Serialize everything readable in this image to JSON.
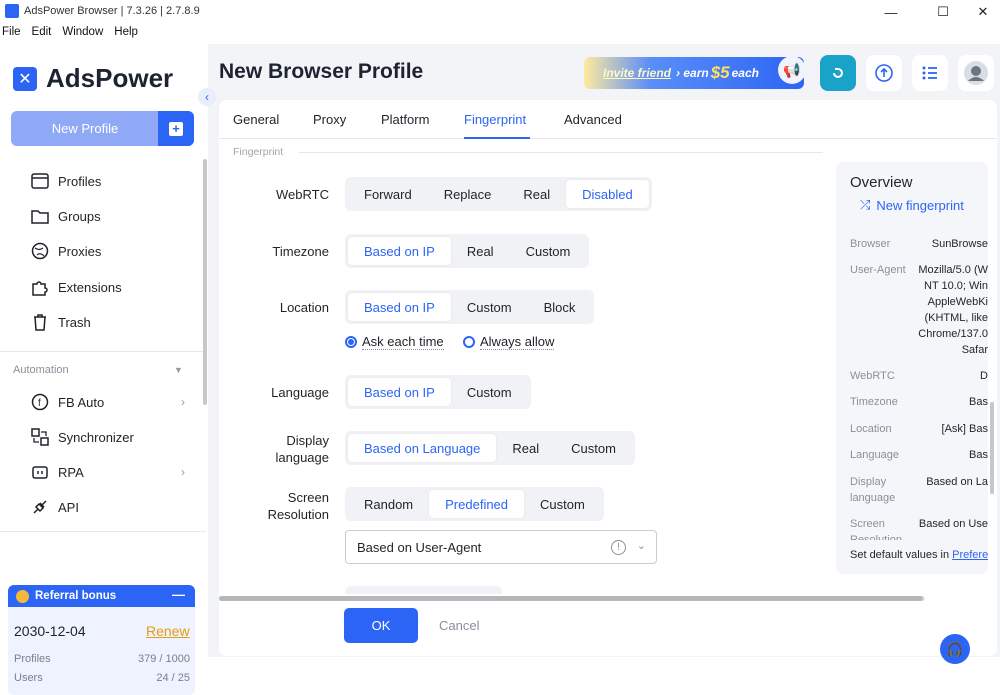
{
  "window": {
    "title": "AdsPower Browser | 7.3.26 | 2.7.8.9",
    "minimize": "—",
    "maximize": "☐",
    "close": "✕"
  },
  "menu": [
    "File",
    "Edit",
    "Window",
    "Help"
  ],
  "sidebar": {
    "brand": "AdsPower",
    "new_profile": "New Profile",
    "items": [
      {
        "label": "Profiles",
        "icon": "profiles-icon"
      },
      {
        "label": "Groups",
        "icon": "folder-icon"
      },
      {
        "label": "Proxies",
        "icon": "globe-icon"
      },
      {
        "label": "Extensions",
        "icon": "puzzle-icon"
      },
      {
        "label": "Trash",
        "icon": "trash-icon"
      }
    ],
    "automation_title": "Automation",
    "automation_items": [
      {
        "label": "FB Auto",
        "icon": "facebook-icon",
        "chevron": "›"
      },
      {
        "label": "Synchronizer",
        "icon": "sync-icon",
        "chevron": ""
      },
      {
        "label": "RPA",
        "icon": "robot-icon",
        "chevron": "›"
      },
      {
        "label": "API",
        "icon": "api-icon",
        "chevron": ""
      }
    ],
    "referral": {
      "title": "Referral bonus",
      "date": "2030-12-04",
      "renew": "Renew",
      "profiles_label": "Profiles",
      "profiles_value": "379 / 1000",
      "users_label": "Users",
      "users_value": "24 / 25"
    }
  },
  "header": {
    "title": "New Browser Profile",
    "banner_text": "Invite friend",
    "banner_earn": "› earn",
    "banner_amount": "$5",
    "banner_each": "each"
  },
  "tabs": [
    "General",
    "Proxy",
    "Platform",
    "Fingerprint",
    "Advanced"
  ],
  "active_tab": "Fingerprint",
  "section_label": "Fingerprint",
  "form": {
    "webrtc": {
      "label": "WebRTC",
      "options": [
        "Forward",
        "Replace",
        "Real",
        "Disabled"
      ],
      "selected": "Disabled"
    },
    "timezone": {
      "label": "Timezone",
      "options": [
        "Based on IP",
        "Real",
        "Custom"
      ],
      "selected": "Based on IP"
    },
    "location": {
      "label": "Location",
      "options": [
        "Based on IP",
        "Custom",
        "Block"
      ],
      "selected": "Based on IP",
      "radio_ask": "Ask each time",
      "radio_allow": "Always allow",
      "radio_selected": "Ask each time"
    },
    "language": {
      "label": "Language",
      "options": [
        "Based on IP",
        "Custom"
      ],
      "selected": "Based on IP"
    },
    "display_language": {
      "label_line1": "Display",
      "label_line2": "language",
      "options": [
        "Based on Language",
        "Real",
        "Custom"
      ],
      "selected": "Based on Language"
    },
    "screen_resolution": {
      "label_line1": "Screen",
      "label_line2": "Resolution",
      "options": [
        "Random",
        "Predefined",
        "Custom"
      ],
      "selected": "Predefined",
      "select_value": "Based on User-Agent"
    }
  },
  "footer": {
    "ok": "OK",
    "cancel": "Cancel"
  },
  "overview": {
    "title": "Overview",
    "new_fingerprint": "New fingerprint",
    "rows": [
      {
        "key": "Browser",
        "value": "SunBrowse"
      },
      {
        "key": "User-Agent",
        "value": "Mozilla/5.0 (W\nNT 10.0; Win\nAppleWebKi\n(KHTML, like\nChrome/137.0\nSafar"
      },
      {
        "key": "WebRTC",
        "value": "D"
      },
      {
        "key": "Timezone",
        "value": "Bas"
      },
      {
        "key": "Location",
        "value": "[Ask] Bas"
      },
      {
        "key": "Language",
        "value": "Bas"
      },
      {
        "key": "Display\nlanguage",
        "value": "Based on La"
      },
      {
        "key": "Screen\nResolution",
        "value": "Based on Use"
      }
    ],
    "footer_text": "Set default values in ",
    "footer_link": "Prefere"
  },
  "colors": {
    "accent": "#2c64f5",
    "renew": "#e79b13",
    "background": "#f3f4f7"
  }
}
